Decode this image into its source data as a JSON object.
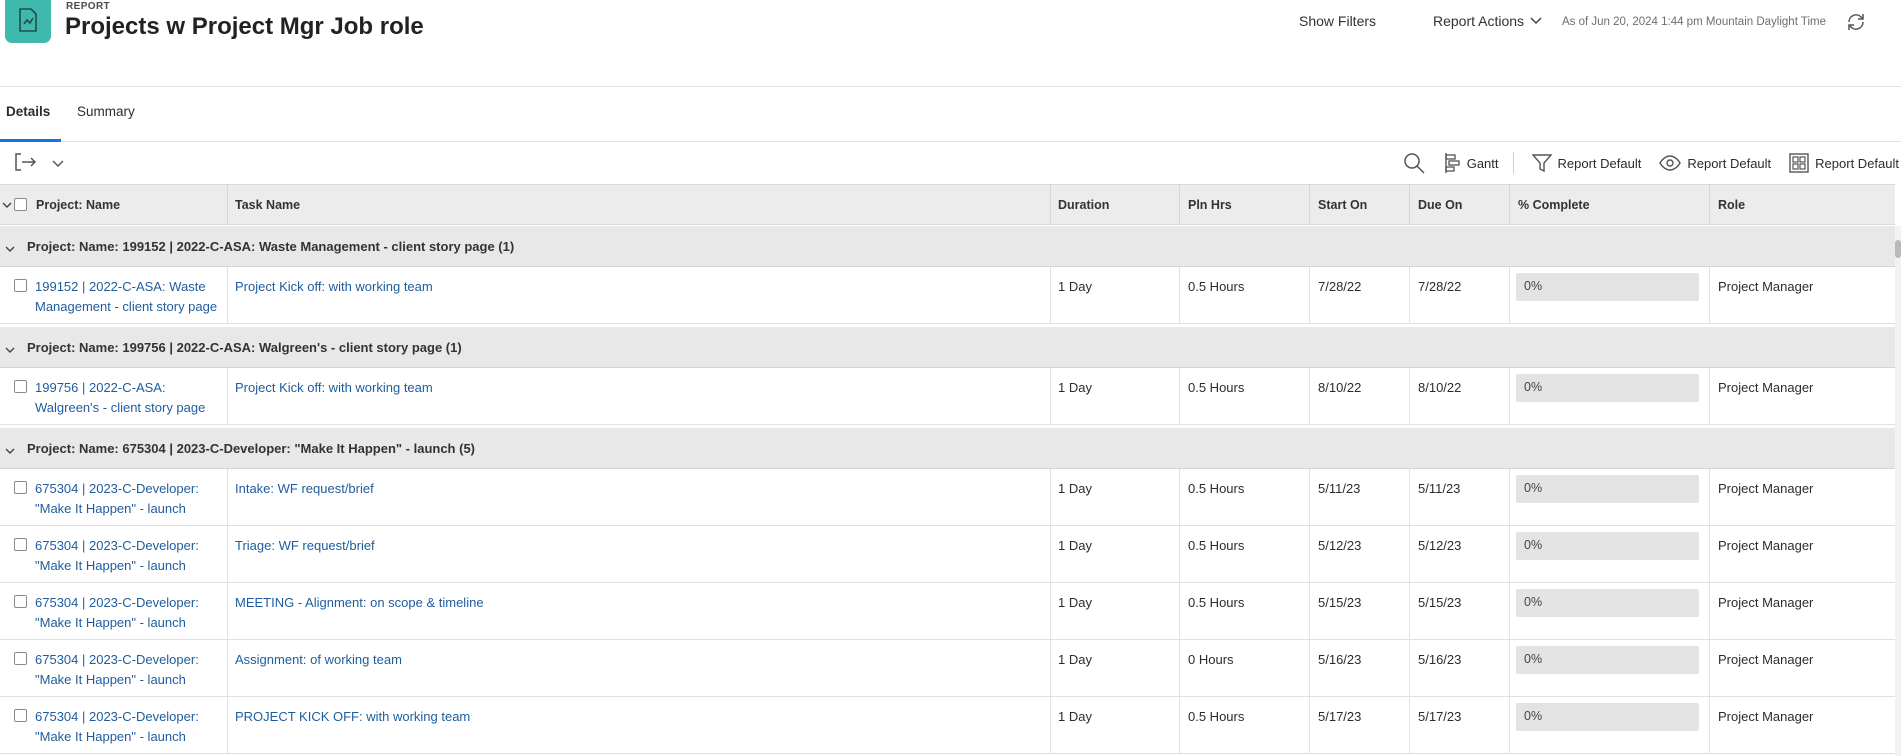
{
  "header": {
    "kicker": "REPORT",
    "title": "Projects w Project Mgr Job role",
    "show_filters": "Show Filters",
    "report_actions": "Report Actions",
    "as_of": "As of Jun 20, 2024 1:44 pm Mountain Daylight Time"
  },
  "tabs": {
    "details": "Details",
    "summary": "Summary"
  },
  "toolbar": {
    "gantt": "Gantt",
    "filter_label": "Report Default",
    "view_label": "Report Default",
    "grouping_label": "Report Default"
  },
  "columns": {
    "project_name": "Project: Name",
    "task_name": "Task Name",
    "duration": "Duration",
    "pln_hrs": "Pln Hrs",
    "start_on": "Start On",
    "due_on": "Due On",
    "pct_complete": "% Complete",
    "role": "Role"
  },
  "groups": [
    {
      "label": "Project: Name: 199152 | 2022-C-ASA: Waste Management - client story page (1)",
      "rows": [
        {
          "project_line1": "199152 | 2022-C-ASA: Waste",
          "project_line2": "Management - client story page",
          "task": "Project Kick off: with working team",
          "duration": "1 Day",
          "pln_hrs": "0.5 Hours",
          "start": "7/28/22",
          "due": "7/28/22",
          "pct": "0%",
          "role": "Project Manager"
        }
      ]
    },
    {
      "label": "Project: Name: 199756 | 2022-C-ASA: Walgreen's - client story page (1)",
      "rows": [
        {
          "project_line1": "199756 | 2022-C-ASA:",
          "project_line2": "Walgreen's - client story page",
          "task": "Project Kick off: with working team",
          "duration": "1 Day",
          "pln_hrs": "0.5 Hours",
          "start": "8/10/22",
          "due": "8/10/22",
          "pct": "0%",
          "role": "Project Manager"
        }
      ]
    },
    {
      "label": "Project: Name: 675304 | 2023-C-Developer: \"Make It Happen\" - launch (5)",
      "rows": [
        {
          "project_line1": "675304 | 2023-C-Developer:",
          "project_line2": "\"Make It Happen\" - launch",
          "task": "Intake: WF request/brief",
          "duration": "1 Day",
          "pln_hrs": "0.5 Hours",
          "start": "5/11/23",
          "due": "5/11/23",
          "pct": "0%",
          "role": "Project Manager"
        },
        {
          "project_line1": "675304 | 2023-C-Developer:",
          "project_line2": "\"Make It Happen\" - launch",
          "task": "Triage: WF request/brief",
          "duration": "1 Day",
          "pln_hrs": "0.5 Hours",
          "start": "5/12/23",
          "due": "5/12/23",
          "pct": "0%",
          "role": "Project Manager"
        },
        {
          "project_line1": "675304 | 2023-C-Developer:",
          "project_line2": "\"Make It Happen\" - launch",
          "task": "MEETING - Alignment: on scope & timeline",
          "duration": "1 Day",
          "pln_hrs": "0.5 Hours",
          "start": "5/15/23",
          "due": "5/15/23",
          "pct": "0%",
          "role": "Project Manager"
        },
        {
          "project_line1": "675304 | 2023-C-Developer:",
          "project_line2": "\"Make It Happen\" - launch",
          "task": "Assignment: of working team",
          "duration": "1 Day",
          "pln_hrs": "0 Hours",
          "start": "5/16/23",
          "due": "5/16/23",
          "pct": "0%",
          "role": "Project Manager"
        },
        {
          "project_line1": "675304 | 2023-C-Developer:",
          "project_line2": "\"Make It Happen\" - launch",
          "task": "PROJECT KICK OFF: with working team",
          "duration": "1 Day",
          "pln_hrs": "0.5 Hours",
          "start": "5/17/23",
          "due": "5/17/23",
          "pct": "0%",
          "role": "Project Manager"
        }
      ]
    }
  ]
}
